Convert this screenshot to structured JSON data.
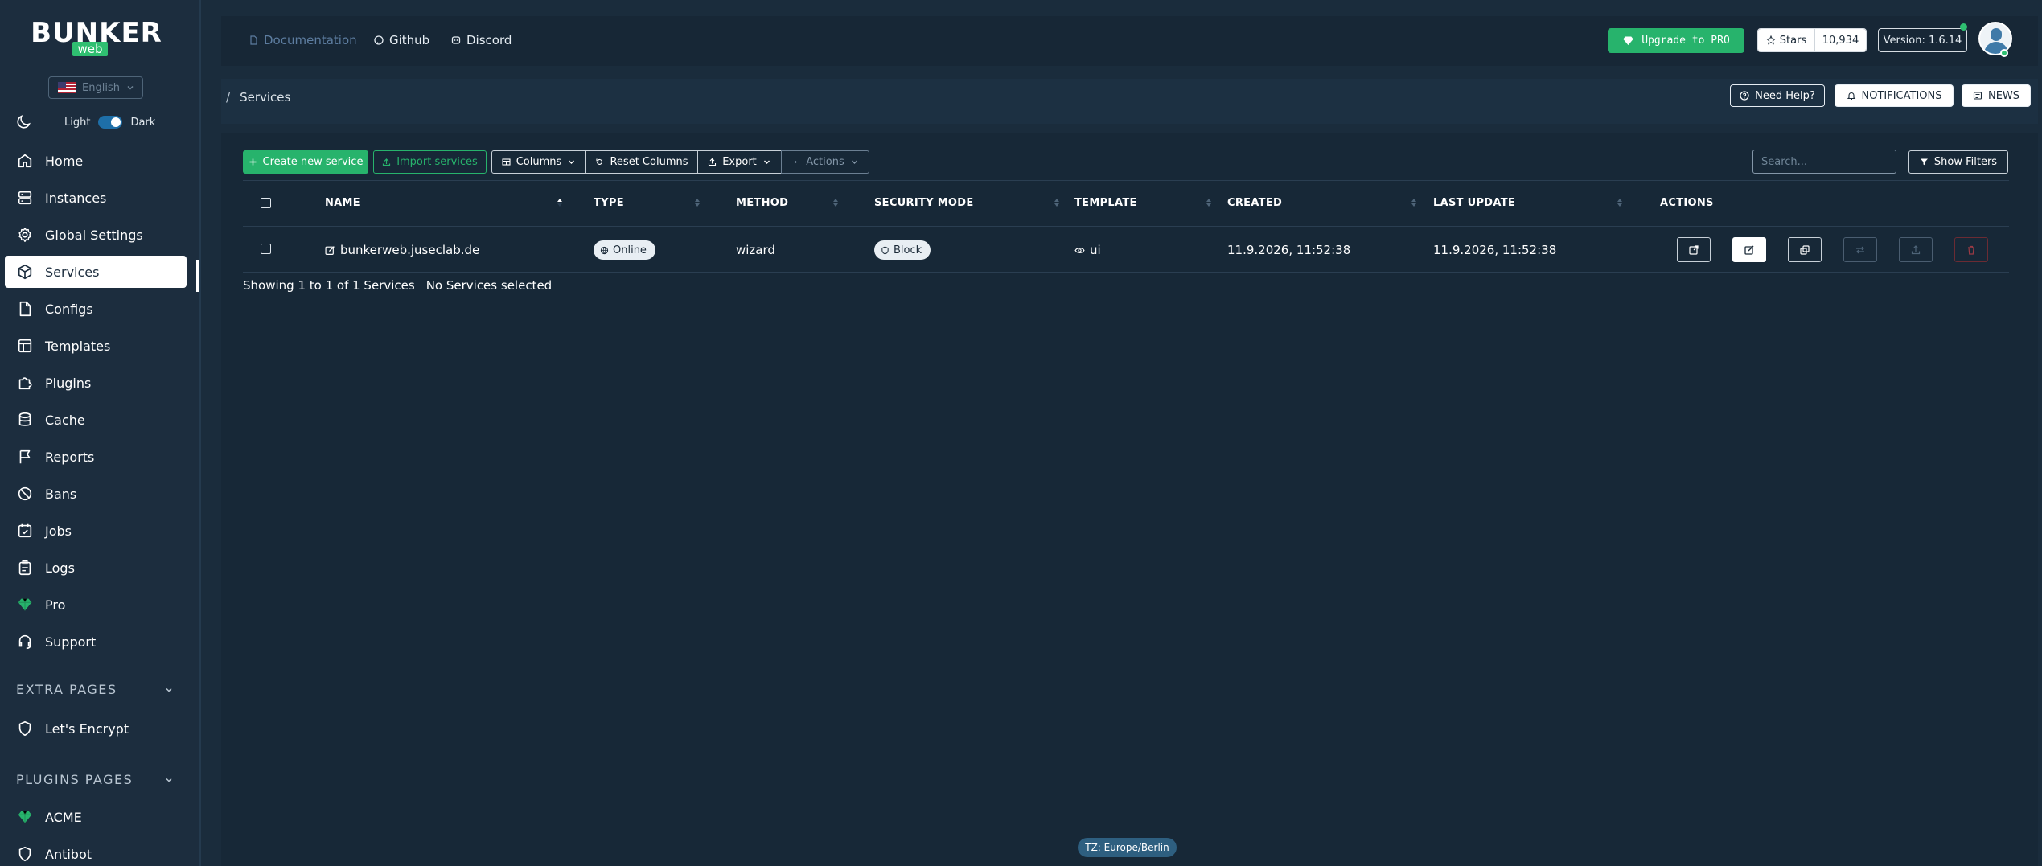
{
  "sidebar": {
    "logo_text": "BUNKER",
    "logo_sub": "web",
    "language": "English",
    "theme": {
      "light": "Light",
      "dark": "Dark"
    },
    "items": [
      {
        "label": "Home",
        "icon": "home-icon"
      },
      {
        "label": "Instances",
        "icon": "server-icon"
      },
      {
        "label": "Global Settings",
        "icon": "gear-icon"
      },
      {
        "label": "Services",
        "icon": "cube-icon"
      },
      {
        "label": "Configs",
        "icon": "file-icon"
      },
      {
        "label": "Templates",
        "icon": "layout-icon"
      },
      {
        "label": "Plugins",
        "icon": "puzzle-icon"
      },
      {
        "label": "Cache",
        "icon": "database-icon"
      },
      {
        "label": "Reports",
        "icon": "flag-icon"
      },
      {
        "label": "Bans",
        "icon": "ban-icon"
      },
      {
        "label": "Jobs",
        "icon": "calendar-check-icon"
      },
      {
        "label": "Logs",
        "icon": "clipboard-icon"
      },
      {
        "label": "Pro",
        "icon": "diamond-icon"
      },
      {
        "label": "Support",
        "icon": "headset-icon"
      }
    ],
    "extra_pages": {
      "title": "EXTRA PAGES",
      "items": [
        {
          "label": "Let's Encrypt",
          "icon": "shield-icon"
        }
      ]
    },
    "plugins_pages": {
      "title": "PLUGINS PAGES",
      "items": [
        {
          "label": "ACME",
          "icon": "diamond-icon"
        },
        {
          "label": "Antibot",
          "icon": "shield-icon"
        }
      ]
    }
  },
  "topbar": {
    "links": [
      "Documentation",
      "Github",
      "Discord"
    ],
    "upgrade": "Upgrade to PRO",
    "stars_label": "Stars",
    "stars_count": "10,934",
    "version": "Version: 1.6.14"
  },
  "subbar": {
    "breadcrumb_sep": "/",
    "breadcrumb": "Services",
    "need_help": "Need Help?",
    "notifications": "NOTIFICATIONS",
    "news": "NEWS"
  },
  "toolbar": {
    "create": "Create new service",
    "import": "Import services",
    "columns": "Columns",
    "reset": "Reset Columns",
    "export": "Export",
    "actions": "Actions",
    "search_placeholder": "Search...",
    "filters": "Show Filters"
  },
  "table": {
    "headers": [
      "NAME",
      "TYPE",
      "METHOD",
      "SECURITY MODE",
      "TEMPLATE",
      "CREATED",
      "LAST UPDATE",
      "ACTIONS"
    ],
    "rows": [
      {
        "name": "bunkerweb.juseclab.de",
        "type": "Online",
        "method": "wizard",
        "security_mode": "Block",
        "template": "ui",
        "created": "11.9.2026, 11:52:38",
        "last_update": "11.9.2026, 11:52:38"
      }
    ],
    "info": "Showing 1 to 1 of 1 Services",
    "selection": "No Services selected"
  },
  "footer": {
    "timezone": "TZ: Europe/Berlin"
  },
  "colors": {
    "accent": "#27b36c",
    "background": "#1a2c3c",
    "danger": "#c0392b"
  }
}
